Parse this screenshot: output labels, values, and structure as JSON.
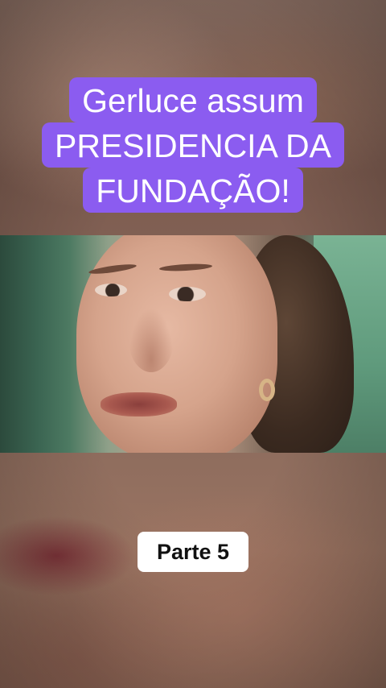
{
  "title": {
    "lines": [
      "Gerluce assum",
      "PRESIDENCIA DA",
      "FUNDAÇÃO!"
    ],
    "highlight_color": "#8b5cf0"
  },
  "part_label": "Parte 5"
}
